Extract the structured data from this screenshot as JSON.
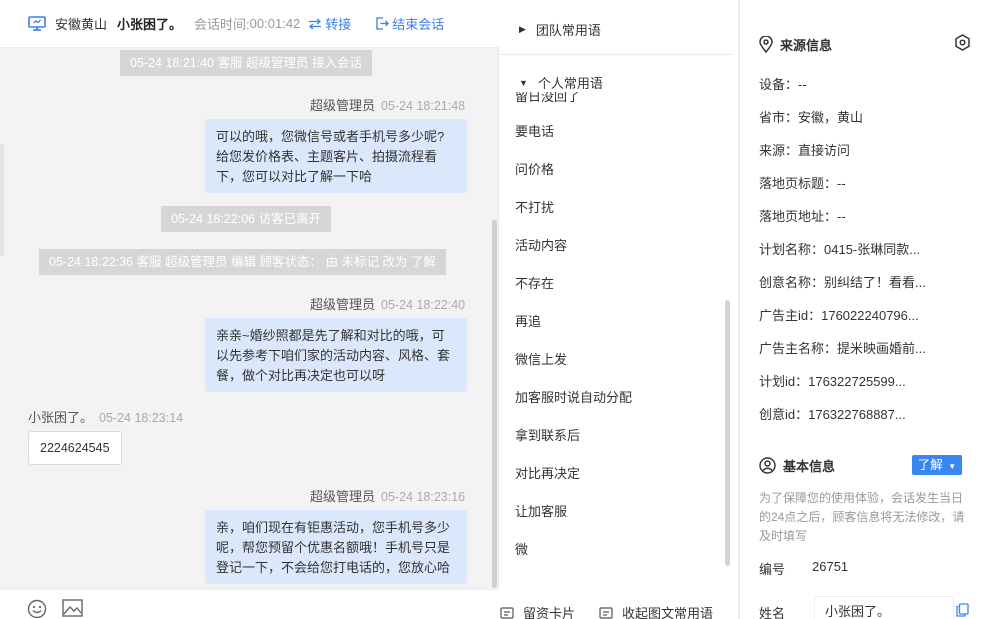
{
  "chat": {
    "header": {
      "location": "安徽黄山",
      "visitor_name": "小张困了。",
      "duration_label": "会话时间:",
      "duration": "00:01:42",
      "transfer_label": "转接",
      "end_label": "结束会话"
    },
    "system_messages": [
      "05-24 18:21:40 客服 超级管理员 接入会话",
      "05-24 18:22:06 访客已离开",
      "05-24 18:22:36 客服 超级管理员 编辑 顾客状态： 由 未标记 改为 了解"
    ],
    "messages": [
      {
        "sender": "超级管理员",
        "time": "05-24 18:21:48",
        "text": "可以的哦，您微信号或者手机号多少呢?给您发价格表、主题客片、拍摄流程看下，您可以对比了解一下哈"
      },
      {
        "sender": "超级管理员",
        "time": "05-24 18:22:40",
        "text": "亲亲~婚纱照都是先了解和对比的哦，可以先参考下咱们家的活动内容、风格、套餐，做个对比再决定也可以呀"
      },
      {
        "sender": "小张困了。",
        "time": "05-24 18:23:14",
        "text": "2224624545"
      },
      {
        "sender": "超级管理员",
        "time": "05-24 18:23:16",
        "text": "亲，咱们现在有钜惠活动，您手机号多少呢，帮您预留个优惠名额哦！手机号只是登记一下，不会给您打电话的，您放心哈"
      }
    ]
  },
  "phrases": {
    "team_group": "团队常用语",
    "personal_group": "个人常用语",
    "cut_item": "留日没回了",
    "items": [
      "要电话",
      "问价格",
      "不打扰",
      "活动内容",
      "不存在",
      "再追",
      "微信上发",
      "加客服时说自动分配",
      "拿到联系后",
      "对比再决定",
      "让加客服",
      "微"
    ],
    "footer_card": "留资卡片",
    "footer_collect": "收起图文常用语"
  },
  "info": {
    "source_title": "来源信息",
    "fields": [
      "设备：--",
      "省市：安徽，黄山",
      "来源：直接访问",
      "落地页标题：--",
      "落地页地址：--",
      "计划名称：0415-张琳同款...",
      "创意名称：别纠结了！看看...",
      "广告主id：176022240796...",
      "广告主名称：提米映画婚前...",
      "计划id：176322725599...",
      "创意id：176322768887..."
    ],
    "basic_title": "基本信息",
    "learn_label": "了解",
    "note": "为了保障您的使用体验，会话发生当日的24点之后，顾客信息将无法修改，请及时填写",
    "id_label": "编号",
    "id_value": "26751",
    "name_label": "姓名",
    "name_value": "小张困了。"
  },
  "colors": {
    "accent": "#3a7ee8",
    "agent_bubble": "#dbe8fb",
    "system_pill": "#d6d6d6"
  }
}
